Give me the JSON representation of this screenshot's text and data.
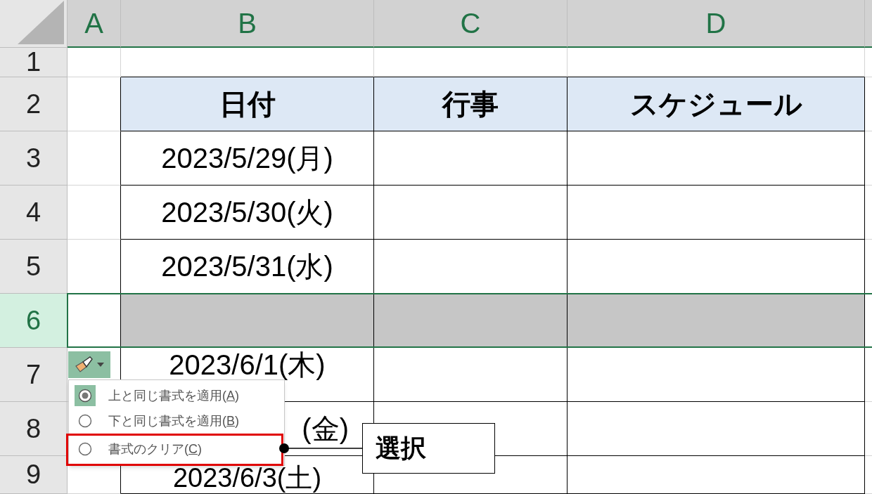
{
  "column_headers": [
    {
      "label": "A",
      "highlighted": true
    },
    {
      "label": "B",
      "highlighted": true
    },
    {
      "label": "C",
      "highlighted": true
    },
    {
      "label": "D",
      "highlighted": true
    }
  ],
  "rows": [
    {
      "number": "1",
      "selected": false,
      "cells": []
    },
    {
      "number": "2",
      "selected": false,
      "cells": [
        {
          "kind": "header",
          "text": "日付"
        },
        {
          "kind": "header",
          "text": "行事"
        },
        {
          "kind": "header",
          "text": "スケジュール"
        }
      ]
    },
    {
      "number": "3",
      "selected": false,
      "cells": [
        {
          "kind": "data",
          "text": "2023/5/29(月)"
        },
        {
          "kind": "data"
        },
        {
          "kind": "data"
        }
      ]
    },
    {
      "number": "4",
      "selected": false,
      "cells": [
        {
          "kind": "data",
          "text": "2023/5/30(火)"
        },
        {
          "kind": "data"
        },
        {
          "kind": "data"
        }
      ]
    },
    {
      "number": "5",
      "selected": false,
      "cells": [
        {
          "kind": "data",
          "text": "2023/5/31(水)"
        },
        {
          "kind": "data"
        },
        {
          "kind": "data"
        }
      ]
    },
    {
      "number": "6",
      "selected": true,
      "cells": [
        {
          "kind": "data"
        },
        {
          "kind": "data"
        },
        {
          "kind": "data"
        }
      ]
    },
    {
      "number": "7",
      "selected": false,
      "cells": [
        {
          "kind": "data",
          "text": "2023/6/1(木)"
        },
        {
          "kind": "data"
        },
        {
          "kind": "data"
        }
      ]
    },
    {
      "number": "8",
      "selected": false,
      "cells": [
        {
          "kind": "data",
          "text": "(金)"
        },
        {
          "kind": "data"
        },
        {
          "kind": "data"
        }
      ]
    },
    {
      "number": "9",
      "selected": false,
      "cells": [
        {
          "kind": "data",
          "text": "2023/6/3(土)"
        },
        {
          "kind": "data"
        },
        {
          "kind": "data"
        }
      ]
    }
  ],
  "insert_options_menu": {
    "items": [
      {
        "label_start": "上と同じ書式を適用(",
        "access_key": "A",
        "label_end": ")",
        "selected": true,
        "highlighted": false
      },
      {
        "label_start": "下と同じ書式を適用(",
        "access_key": "B",
        "label_end": ")",
        "selected": false,
        "highlighted": false
      },
      {
        "label_start": "書式のクリア(",
        "access_key": "C",
        "label_end": ")",
        "selected": false,
        "highlighted": true
      }
    ]
  },
  "callout": {
    "text": "選択"
  }
}
